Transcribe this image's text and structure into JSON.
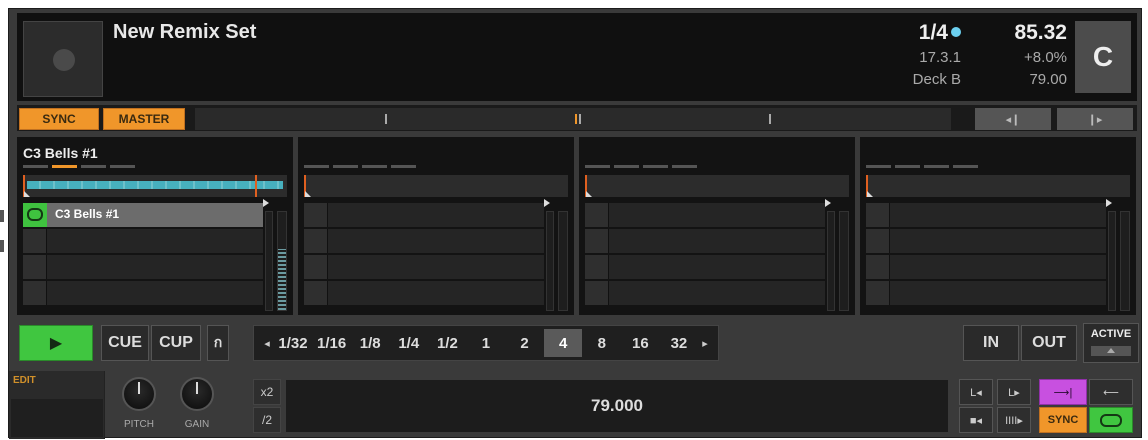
{
  "header": {
    "title": "New Remix Set",
    "beat_fraction": "1/4",
    "position": "17.3.1",
    "deck_name": "Deck B",
    "tempo": "85.32",
    "pitch_percent": "+8.0%",
    "original_tempo": "79.00",
    "key": "C"
  },
  "sync_strip": {
    "sync_label": "SYNC",
    "master_label": "MASTER",
    "nudge_back_label": "◂❙",
    "nudge_forward_label": "❙▸"
  },
  "slots": [
    {
      "name": "C3 Bells #1",
      "active_bar": 1,
      "cells": [
        {
          "label": "C3 Bells #1",
          "loaded": true
        },
        {
          "label": "",
          "loaded": false
        },
        {
          "label": "",
          "loaded": false
        },
        {
          "label": "",
          "loaded": false
        }
      ],
      "meter_level": 0.62
    },
    {
      "name": "",
      "active_bar": -1,
      "cells": [
        {
          "label": "",
          "loaded": false
        },
        {
          "label": "",
          "loaded": false
        },
        {
          "label": "",
          "loaded": false
        },
        {
          "label": "",
          "loaded": false
        }
      ],
      "meter_level": 0
    },
    {
      "name": "",
      "active_bar": -1,
      "cells": [
        {
          "label": "",
          "loaded": false
        },
        {
          "label": "",
          "loaded": false
        },
        {
          "label": "",
          "loaded": false
        },
        {
          "label": "",
          "loaded": false
        }
      ],
      "meter_level": 0
    },
    {
      "name": "",
      "active_bar": -1,
      "cells": [
        {
          "label": "",
          "loaded": false
        },
        {
          "label": "",
          "loaded": false
        },
        {
          "label": "",
          "loaded": false
        },
        {
          "label": "",
          "loaded": false
        }
      ],
      "meter_level": 0
    }
  ],
  "transport": {
    "play_label": "▶",
    "cue_label": "CUE",
    "cup_label": "CUP",
    "flux_label": "ก",
    "loop_sizes": [
      "1/32",
      "1/16",
      "1/8",
      "1/4",
      "1/2",
      "1",
      "2",
      "4",
      "8",
      "16",
      "32"
    ],
    "selected_loop_size": "4",
    "in_label": "IN",
    "out_label": "OUT",
    "active_label": "ACTIVE"
  },
  "bottom": {
    "edit_label": "EDIT",
    "pitch_label": "PITCH",
    "gain_label": "GAIN",
    "x2_label": "x2",
    "div2_label": "/2",
    "tempo_value": "79.000",
    "sync_mini_label": "SYNC",
    "mini_a_label": "L◂",
    "mini_b_label": "L▸",
    "mini_c_label": "■◂",
    "mini_d_label": "IIII▸",
    "flux_mode_label": "⟶|",
    "back_arrow_label": "⟵"
  },
  "colors": {
    "accent_orange": "#f0962a",
    "play_green": "#40c640",
    "flux_purple": "#c850e0",
    "waveform_cyan": "#4cc7d8"
  }
}
